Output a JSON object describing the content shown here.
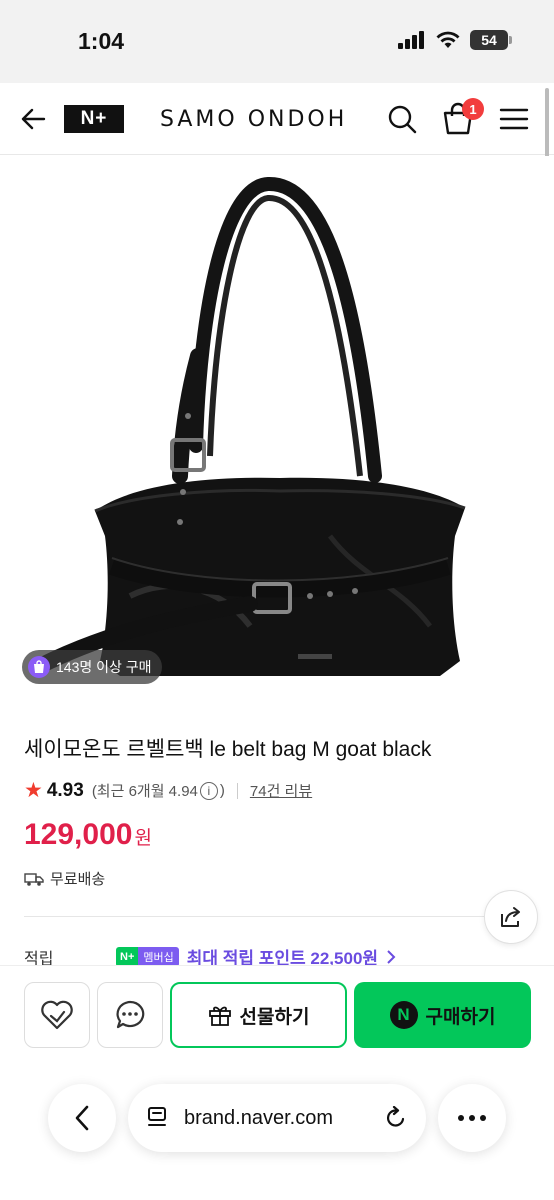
{
  "status": {
    "time": "1:04",
    "battery": "54"
  },
  "header": {
    "logo": "N+",
    "brand": "SAMO ONDOH",
    "cart_count": "1"
  },
  "product": {
    "buyers_badge": "143명 이상 구매",
    "title": "세이모온도 르벨트백 le belt bag M goat black",
    "rating": "4.93",
    "rating_recent_prefix": "(최근 6개월 4.94",
    "rating_recent_suffix": ")",
    "review_count": "74건 리뷰",
    "price": "129,000",
    "price_unit": "원",
    "shipping": "무료배송",
    "points_label": "적립",
    "membership_badge_n": "N+",
    "membership_badge_text": "멤버십",
    "points_text": "최대 적립 포인트 22,500원"
  },
  "actions": {
    "gift_label": "선물하기",
    "buy_label": "구매하기"
  },
  "browser": {
    "url": "brand.naver.com"
  },
  "colors": {
    "accent_green": "#03c75a",
    "price_red": "#e0204a",
    "membership_purple": "#6a4ce0",
    "star": "#f03c2e"
  }
}
